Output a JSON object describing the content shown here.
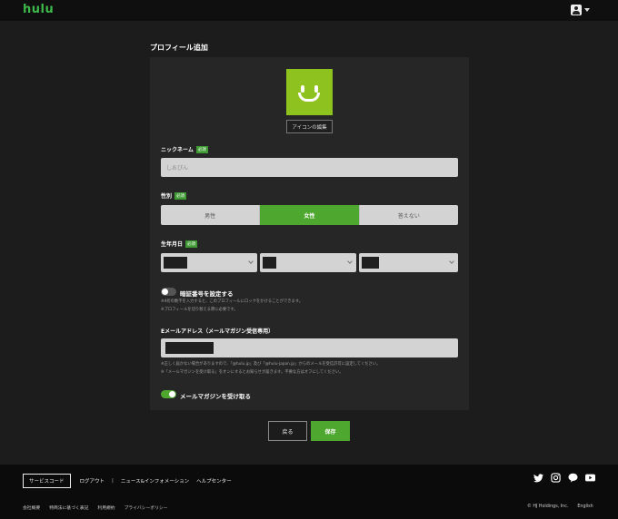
{
  "brand": {
    "logo": "hulu",
    "accent": "#3db84a"
  },
  "header": {
    "account_icon": "account-icon"
  },
  "page": {
    "title": "プロフィール追加"
  },
  "avatar": {
    "color": "#8dc21f",
    "edit_label": "アイコンの編集"
  },
  "required_badge": "必須",
  "nickname": {
    "label": "ニックネーム",
    "value": "しおぴん"
  },
  "gender": {
    "label": "性別",
    "options": [
      "男性",
      "女性",
      "答えない"
    ],
    "selected": "女性"
  },
  "birthday": {
    "label": "生年月日"
  },
  "pin": {
    "label": "暗証番号を設定する",
    "enabled": false,
    "notes": [
      "※4桁の数字を入力すると、このプロフィールにロックをかけることができます。",
      "※プロフィールを切り替える際に必要です。"
    ]
  },
  "email": {
    "label": "Eメールアドレス（メールマガジン受信専用）",
    "notes": [
      "※正しく届かない場合がありますので、「@hulu.jp」及び「@hulu-japan.jp」からのメールを受信許可に設定してください。",
      "※「メールマガジンを受け取る」をオンにするとお知らせが届きます。不要な方はオフにしてください。"
    ]
  },
  "newsletter": {
    "label": "メールマガジンを受け取る",
    "enabled": true
  },
  "actions": {
    "back": "戻る",
    "save": "保存"
  },
  "footer": {
    "service_code": "サービスコード",
    "links": [
      "ログアウト",
      "ニュース&インフォメーション",
      "ヘルプセンター"
    ],
    "separator": "|",
    "bottom_links": [
      "会社概要",
      "特商法に基づく表記",
      "利用規約",
      "プライバシーポリシー"
    ],
    "copyright": "© HJ Holdings, Inc.",
    "language": "English",
    "social_icons": [
      "twitter-icon",
      "instagram-icon",
      "line-icon",
      "youtube-icon"
    ]
  }
}
